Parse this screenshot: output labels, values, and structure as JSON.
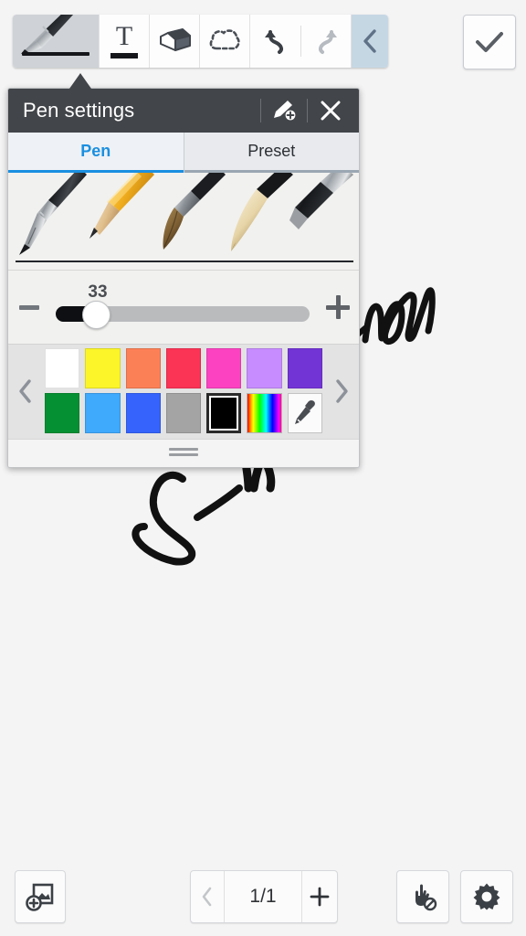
{
  "app": {
    "background_color": "#f4f4f4"
  },
  "toolbar": {
    "tools": [
      {
        "name": "pen-tool",
        "icon": "pen-icon",
        "label": "Pen",
        "selected": true
      },
      {
        "name": "text-tool",
        "icon": "text-t-icon",
        "label": "Text",
        "selected": false
      },
      {
        "name": "eraser-tool",
        "icon": "eraser-icon",
        "label": "Eraser",
        "selected": false
      },
      {
        "name": "select-tool",
        "icon": "lasso-select-icon",
        "label": "Select",
        "selected": false
      }
    ],
    "undo": {
      "label": "Undo",
      "icon": "undo-arrow-icon",
      "enabled": true
    },
    "redo": {
      "label": "Redo",
      "icon": "redo-arrow-icon",
      "enabled": false
    },
    "collapse": {
      "label": "Collapse toolbar",
      "icon": "chevron-left-icon"
    },
    "confirm": {
      "label": "Done",
      "icon": "checkmark-icon"
    }
  },
  "pen_settings": {
    "title": "Pen settings",
    "add_pen": {
      "label": "Add pen",
      "icon": "pen-plus-icon"
    },
    "close": {
      "label": "Close",
      "icon": "close-x-icon"
    },
    "tabs": [
      {
        "label": "Pen",
        "active": true
      },
      {
        "label": "Preset",
        "active": false
      }
    ],
    "pen_types": [
      {
        "name": "fountain-pen",
        "selected": true
      },
      {
        "name": "pencil",
        "selected": false
      },
      {
        "name": "paint-brush",
        "selected": false
      },
      {
        "name": "calligraphy-brush",
        "selected": false
      },
      {
        "name": "marker-pen",
        "selected": false
      }
    ],
    "size_slider": {
      "value": "33",
      "min": 1,
      "max": 100,
      "percent": 14,
      "decrease_label": "−",
      "increase_label": "+"
    },
    "palette": {
      "prev_label": "Previous colors",
      "next_label": "More colors",
      "prev_icon": "chevron-left-icon",
      "next_icon": "chevron-right-icon",
      "swatches": [
        {
          "name": "white",
          "color": "#ffffff",
          "selected": false
        },
        {
          "name": "yellow",
          "color": "#fbf52a",
          "selected": false
        },
        {
          "name": "orange",
          "color": "#fc8056",
          "selected": false
        },
        {
          "name": "red",
          "color": "#fb3355",
          "selected": false
        },
        {
          "name": "pink",
          "color": "#fc42c1",
          "selected": false
        },
        {
          "name": "light-purple",
          "color": "#c78cff",
          "selected": false
        },
        {
          "name": "purple",
          "color": "#7334d6",
          "selected": false
        },
        {
          "name": "green",
          "color": "#059033",
          "selected": false
        },
        {
          "name": "light-blue",
          "color": "#3fa9fc",
          "selected": false
        },
        {
          "name": "blue",
          "color": "#3563fb",
          "selected": false
        },
        {
          "name": "gray",
          "color": "#a4a4a4",
          "selected": false
        },
        {
          "name": "black",
          "color": "#000000",
          "selected": true
        },
        {
          "name": "spectrum",
          "color": "spectrum",
          "selected": false
        },
        {
          "name": "eyedropper",
          "color": "eyedropper",
          "selected": false
        }
      ]
    },
    "drag_handle": {
      "label": "Move panel",
      "icon": "drag-handle-icon"
    }
  },
  "bottom_bar": {
    "add_image": {
      "label": "Add image",
      "icon": "add-image-icon"
    },
    "page_nav": {
      "prev": {
        "label": "Previous page",
        "icon": "chevron-left-icon",
        "enabled": false
      },
      "indicator": "1/1",
      "add": {
        "label": "Add page",
        "icon": "plus-icon"
      }
    },
    "palm_reject": {
      "label": "Palm rejection",
      "icon": "hand-block-icon"
    },
    "settings": {
      "label": "Settings",
      "icon": "gear-icon"
    }
  },
  "canvas": {
    "ink_notes": [
      {
        "name": "ink-stroke-new",
        "text": "new"
      },
      {
        "name": "ink-stroke-signature",
        "text": "S-N"
      }
    ],
    "ink_color": "#111111"
  }
}
